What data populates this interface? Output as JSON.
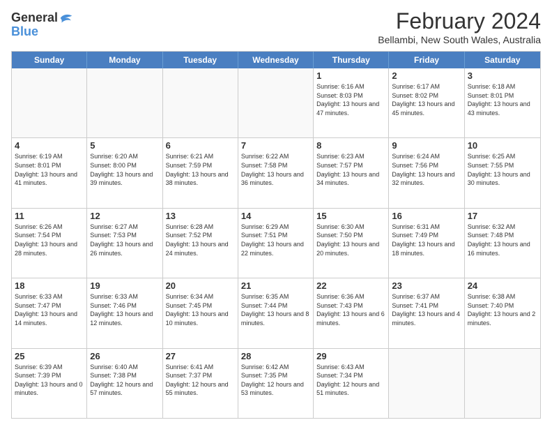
{
  "header": {
    "logo_line1": "General",
    "logo_line2": "Blue",
    "title": "February 2024",
    "subtitle": "Bellambi, New South Wales, Australia"
  },
  "days_of_week": [
    "Sunday",
    "Monday",
    "Tuesday",
    "Wednesday",
    "Thursday",
    "Friday",
    "Saturday"
  ],
  "weeks": [
    [
      {
        "num": "",
        "info": ""
      },
      {
        "num": "",
        "info": ""
      },
      {
        "num": "",
        "info": ""
      },
      {
        "num": "",
        "info": ""
      },
      {
        "num": "1",
        "info": "Sunrise: 6:16 AM\nSunset: 8:03 PM\nDaylight: 13 hours and 47 minutes."
      },
      {
        "num": "2",
        "info": "Sunrise: 6:17 AM\nSunset: 8:02 PM\nDaylight: 13 hours and 45 minutes."
      },
      {
        "num": "3",
        "info": "Sunrise: 6:18 AM\nSunset: 8:01 PM\nDaylight: 13 hours and 43 minutes."
      }
    ],
    [
      {
        "num": "4",
        "info": "Sunrise: 6:19 AM\nSunset: 8:01 PM\nDaylight: 13 hours and 41 minutes."
      },
      {
        "num": "5",
        "info": "Sunrise: 6:20 AM\nSunset: 8:00 PM\nDaylight: 13 hours and 39 minutes."
      },
      {
        "num": "6",
        "info": "Sunrise: 6:21 AM\nSunset: 7:59 PM\nDaylight: 13 hours and 38 minutes."
      },
      {
        "num": "7",
        "info": "Sunrise: 6:22 AM\nSunset: 7:58 PM\nDaylight: 13 hours and 36 minutes."
      },
      {
        "num": "8",
        "info": "Sunrise: 6:23 AM\nSunset: 7:57 PM\nDaylight: 13 hours and 34 minutes."
      },
      {
        "num": "9",
        "info": "Sunrise: 6:24 AM\nSunset: 7:56 PM\nDaylight: 13 hours and 32 minutes."
      },
      {
        "num": "10",
        "info": "Sunrise: 6:25 AM\nSunset: 7:55 PM\nDaylight: 13 hours and 30 minutes."
      }
    ],
    [
      {
        "num": "11",
        "info": "Sunrise: 6:26 AM\nSunset: 7:54 PM\nDaylight: 13 hours and 28 minutes."
      },
      {
        "num": "12",
        "info": "Sunrise: 6:27 AM\nSunset: 7:53 PM\nDaylight: 13 hours and 26 minutes."
      },
      {
        "num": "13",
        "info": "Sunrise: 6:28 AM\nSunset: 7:52 PM\nDaylight: 13 hours and 24 minutes."
      },
      {
        "num": "14",
        "info": "Sunrise: 6:29 AM\nSunset: 7:51 PM\nDaylight: 13 hours and 22 minutes."
      },
      {
        "num": "15",
        "info": "Sunrise: 6:30 AM\nSunset: 7:50 PM\nDaylight: 13 hours and 20 minutes."
      },
      {
        "num": "16",
        "info": "Sunrise: 6:31 AM\nSunset: 7:49 PM\nDaylight: 13 hours and 18 minutes."
      },
      {
        "num": "17",
        "info": "Sunrise: 6:32 AM\nSunset: 7:48 PM\nDaylight: 13 hours and 16 minutes."
      }
    ],
    [
      {
        "num": "18",
        "info": "Sunrise: 6:33 AM\nSunset: 7:47 PM\nDaylight: 13 hours and 14 minutes."
      },
      {
        "num": "19",
        "info": "Sunrise: 6:33 AM\nSunset: 7:46 PM\nDaylight: 13 hours and 12 minutes."
      },
      {
        "num": "20",
        "info": "Sunrise: 6:34 AM\nSunset: 7:45 PM\nDaylight: 13 hours and 10 minutes."
      },
      {
        "num": "21",
        "info": "Sunrise: 6:35 AM\nSunset: 7:44 PM\nDaylight: 13 hours and 8 minutes."
      },
      {
        "num": "22",
        "info": "Sunrise: 6:36 AM\nSunset: 7:43 PM\nDaylight: 13 hours and 6 minutes."
      },
      {
        "num": "23",
        "info": "Sunrise: 6:37 AM\nSunset: 7:41 PM\nDaylight: 13 hours and 4 minutes."
      },
      {
        "num": "24",
        "info": "Sunrise: 6:38 AM\nSunset: 7:40 PM\nDaylight: 13 hours and 2 minutes."
      }
    ],
    [
      {
        "num": "25",
        "info": "Sunrise: 6:39 AM\nSunset: 7:39 PM\nDaylight: 13 hours and 0 minutes."
      },
      {
        "num": "26",
        "info": "Sunrise: 6:40 AM\nSunset: 7:38 PM\nDaylight: 12 hours and 57 minutes."
      },
      {
        "num": "27",
        "info": "Sunrise: 6:41 AM\nSunset: 7:37 PM\nDaylight: 12 hours and 55 minutes."
      },
      {
        "num": "28",
        "info": "Sunrise: 6:42 AM\nSunset: 7:35 PM\nDaylight: 12 hours and 53 minutes."
      },
      {
        "num": "29",
        "info": "Sunrise: 6:43 AM\nSunset: 7:34 PM\nDaylight: 12 hours and 51 minutes."
      },
      {
        "num": "",
        "info": ""
      },
      {
        "num": "",
        "info": ""
      }
    ]
  ]
}
